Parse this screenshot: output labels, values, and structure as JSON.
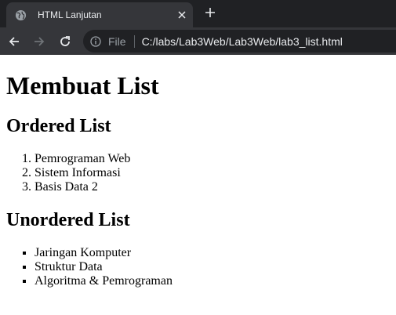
{
  "browser": {
    "tab_title": "HTML Lanjutan",
    "url_scheme": "File",
    "url": "C:/labs/Lab3Web/Lab3Web/lab3_list.html",
    "icons": {
      "favicon": "globe-icon",
      "close": "close-icon",
      "new_tab": "plus-icon",
      "back": "arrow-left-icon",
      "forward": "arrow-right-icon",
      "reload": "reload-icon",
      "site_info": "info-icon"
    }
  },
  "page": {
    "heading": "Membuat List",
    "ordered_heading": "Ordered List",
    "ordered_items": [
      "Pemrograman Web",
      "Sistem Informasi",
      "Basis Data 2"
    ],
    "unordered_heading": "Unordered List",
    "unordered_items": [
      "Jaringan Komputer",
      "Struktur Data",
      "Algoritma & Pemrograman"
    ]
  }
}
